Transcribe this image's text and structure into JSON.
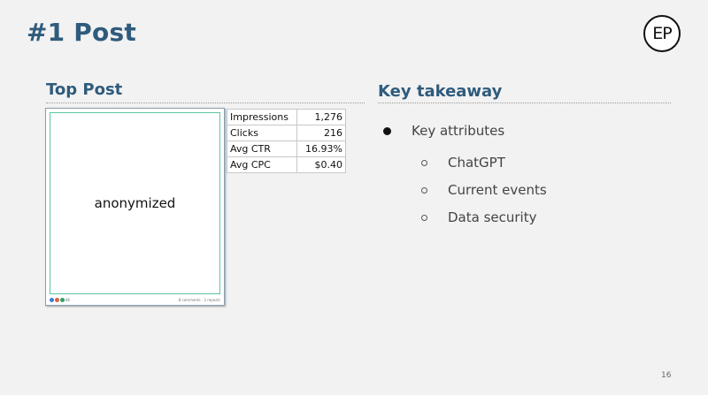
{
  "slide": {
    "title": "#1 Post",
    "logo_text": "EP",
    "page_number": "16"
  },
  "top_post": {
    "heading": "Top Post",
    "image_label": "anonymized",
    "footer_left": "86",
    "footer_right": "8 comments · 2 reposts",
    "metrics": [
      {
        "label": "Impressions",
        "value": "1,276"
      },
      {
        "label": "Clicks",
        "value": "216"
      },
      {
        "label": "Avg CTR",
        "value": "16.93%"
      },
      {
        "label": "Avg CPC",
        "value": "$0.40"
      }
    ]
  },
  "takeaway": {
    "heading": "Key takeaway",
    "bullet": "Key attributes",
    "sub_bullets": [
      "ChatGPT",
      "Current events",
      "Data security"
    ]
  },
  "colors": {
    "title": "#2f5b7c",
    "background": "#f2f2f2",
    "post_border": "#5cc7a0"
  }
}
